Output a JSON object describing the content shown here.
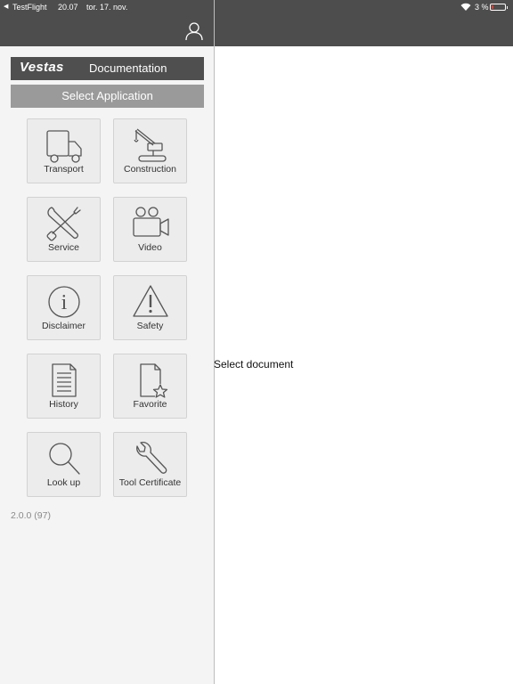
{
  "status_bar": {
    "back_app": "TestFlight",
    "time": "20.07",
    "date": "tor. 17. nov.",
    "battery_percent": "3 %",
    "battery_level": 0.03
  },
  "sidebar": {
    "brand_logo": "Vestas",
    "brand_title": "Documentation",
    "select_application_label": "Select Application",
    "tiles": [
      {
        "label": "Transport",
        "icon": "truck-icon"
      },
      {
        "label": "Construction",
        "icon": "crane-icon"
      },
      {
        "label": "Service",
        "icon": "tools-icon"
      },
      {
        "label": "Video",
        "icon": "video-camera-icon"
      },
      {
        "label": "Disclaimer",
        "icon": "info-icon"
      },
      {
        "label": "Safety",
        "icon": "warning-icon"
      },
      {
        "label": "History",
        "icon": "document-list-icon"
      },
      {
        "label": "Favorite",
        "icon": "document-star-icon"
      },
      {
        "label": "Look up",
        "icon": "magnifier-icon"
      },
      {
        "label": "Tool Certificate",
        "icon": "wrench-icon"
      }
    ],
    "version": "2.0.0 (97)"
  },
  "detail": {
    "message": "Select document"
  },
  "colors": {
    "header": "#4d4d4d",
    "brand_bar": "#4f4f4f",
    "select_bar": "#9a9a9a",
    "sidebar_bg": "#f4f4f4",
    "tile_bg": "#ececec",
    "battery_low": "#ff3b30"
  }
}
